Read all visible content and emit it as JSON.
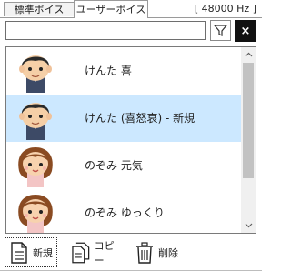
{
  "tabs": [
    {
      "label": "標準ボイス",
      "active": false
    },
    {
      "label": "ユーザーボイス",
      "active": true
    }
  ],
  "sample_rate": "[ 48000 Hz ]",
  "search": {
    "value": "",
    "placeholder": ""
  },
  "icons": {
    "filter": "filter-icon",
    "close": "close-icon"
  },
  "close_label": "×",
  "voices": [
    {
      "label": "けんた 喜",
      "avatar": "male-avatar",
      "selected": false
    },
    {
      "label": "けんた (喜怒哀) - 新規",
      "avatar": "male-avatar",
      "selected": true
    },
    {
      "label": "のぞみ 元気",
      "avatar": "female-avatar",
      "selected": false
    },
    {
      "label": "のぞみ ゆっくり",
      "avatar": "female-avatar",
      "selected": false
    }
  ],
  "buttons": {
    "new_label": "新規",
    "copy_label": "コピー",
    "delete_label": "削除"
  },
  "colors": {
    "selection": "#cce8ff",
    "close_bg": "#111111"
  }
}
